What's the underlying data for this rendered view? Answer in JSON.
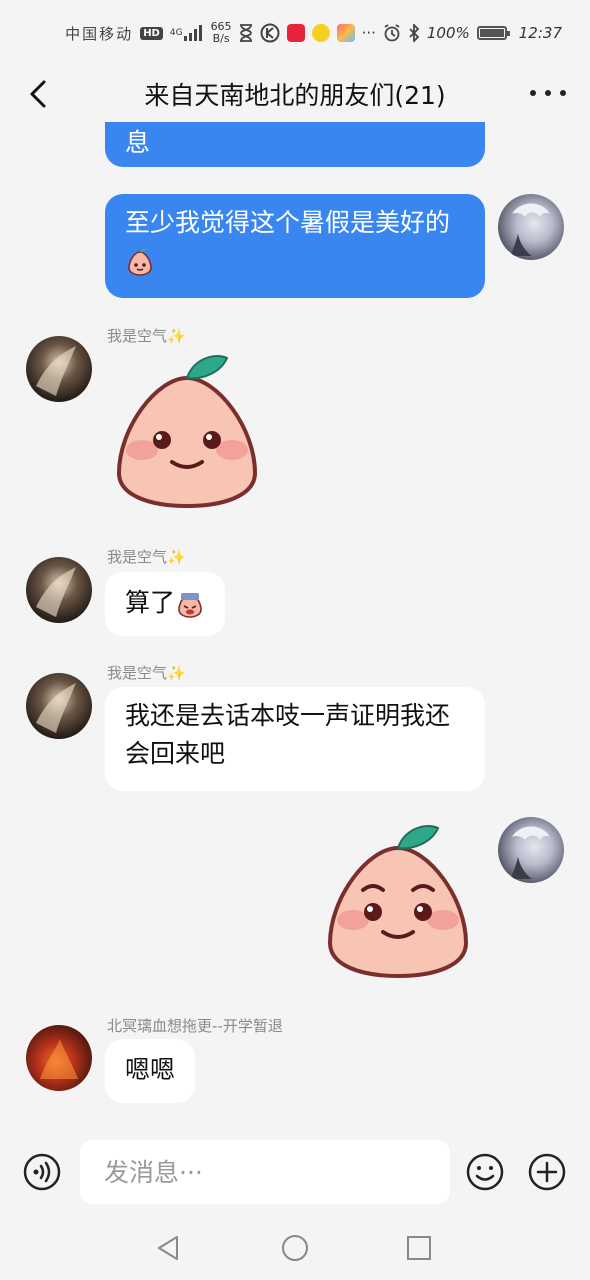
{
  "status_bar": {
    "carrier": "中国移动",
    "hd_badge": "HD",
    "signal": "4G",
    "speed_value": "665",
    "speed_unit": "B/s",
    "battery_percent": "100%",
    "battery_level": 1.0,
    "time": "12:37",
    "overflow": "···"
  },
  "header": {
    "title": "来自天南地北的朋友们(21)"
  },
  "messages": [
    {
      "side": "out",
      "type": "text",
      "text": "息"
    },
    {
      "side": "out",
      "type": "text",
      "text": "至少我觉得这个暑假是美好的"
    },
    {
      "side": "in",
      "sender": "我是空气",
      "sparkle": "✨",
      "type": "sticker",
      "sticker": "peach-smile"
    },
    {
      "side": "in",
      "sender": "我是空气",
      "sparkle": "✨",
      "type": "text",
      "text": "算了"
    },
    {
      "side": "in",
      "sender": "我是空气",
      "sparkle": "✨",
      "type": "text",
      "text": "我还是去话本吱一声证明我还会回来吧"
    },
    {
      "side": "out",
      "type": "sticker",
      "sticker": "peach-smile"
    },
    {
      "side": "in",
      "sender": "北冥璃血想拖更--开学暂退",
      "type": "text",
      "text": "嗯嗯"
    }
  ],
  "input_bar": {
    "placeholder": "发消息···",
    "value": ""
  },
  "colors": {
    "outgoing_bubble": "#3a86f0",
    "incoming_bubble": "#ffffff",
    "background": "#f4f4f4"
  },
  "icons": [
    "back-icon",
    "more-icon",
    "voice-icon",
    "emoji-icon",
    "plus-icon",
    "nav-back-icon",
    "nav-home-icon",
    "nav-recent-icon"
  ]
}
